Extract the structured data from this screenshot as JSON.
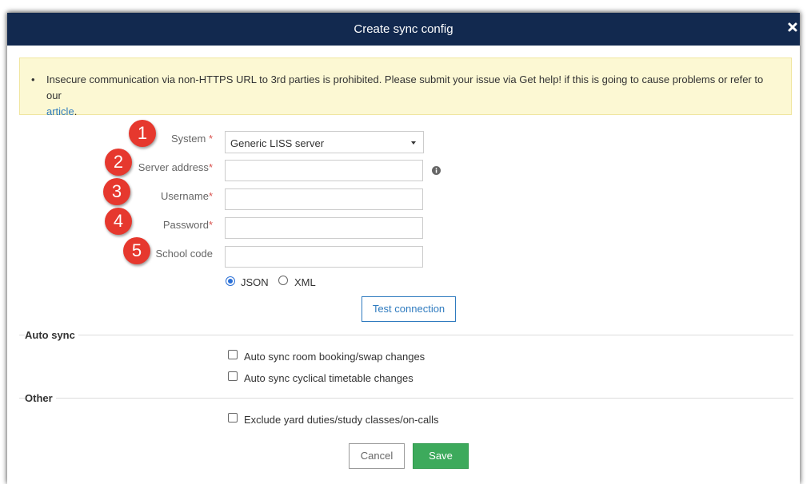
{
  "dialog": {
    "title": "Create sync config"
  },
  "warning": {
    "bullet": "•",
    "text": "Insecure communication via non-HTTPS URL to 3rd parties is prohibited. Please submit your issue via Get help! if this is going to cause problems or refer to our",
    "link": "article",
    "suffix": "."
  },
  "form": {
    "required_mark": "*",
    "system": {
      "label": "System",
      "value": "Generic LISS server"
    },
    "server_address": {
      "label": "Server address",
      "value": ""
    },
    "username": {
      "label": "Username",
      "value": ""
    },
    "password": {
      "label": "Password",
      "value": ""
    },
    "school_code": {
      "label": "School code",
      "value": ""
    },
    "format_options": [
      {
        "label": "JSON",
        "selected": true
      },
      {
        "label": "XML",
        "selected": false
      }
    ],
    "test_connection_label": "Test connection"
  },
  "annotations": [
    "1",
    "2",
    "3",
    "4",
    "5"
  ],
  "auto_sync": {
    "heading": "Auto sync",
    "options": [
      {
        "label": "Auto sync room booking/swap changes",
        "checked": false
      },
      {
        "label": "Auto sync cyclical timetable changes",
        "checked": false
      }
    ]
  },
  "other": {
    "heading": "Other",
    "options": [
      {
        "label": "Exclude yard duties/study classes/on-calls",
        "checked": false
      }
    ]
  },
  "footer": {
    "cancel_label": "Cancel",
    "save_label": "Save"
  },
  "colors": {
    "header_bg": "#12294f",
    "warning_bg": "#fcf8d3",
    "link": "#2f7bbf",
    "save_bg": "#3daa5c",
    "badge": "#e6382e"
  }
}
